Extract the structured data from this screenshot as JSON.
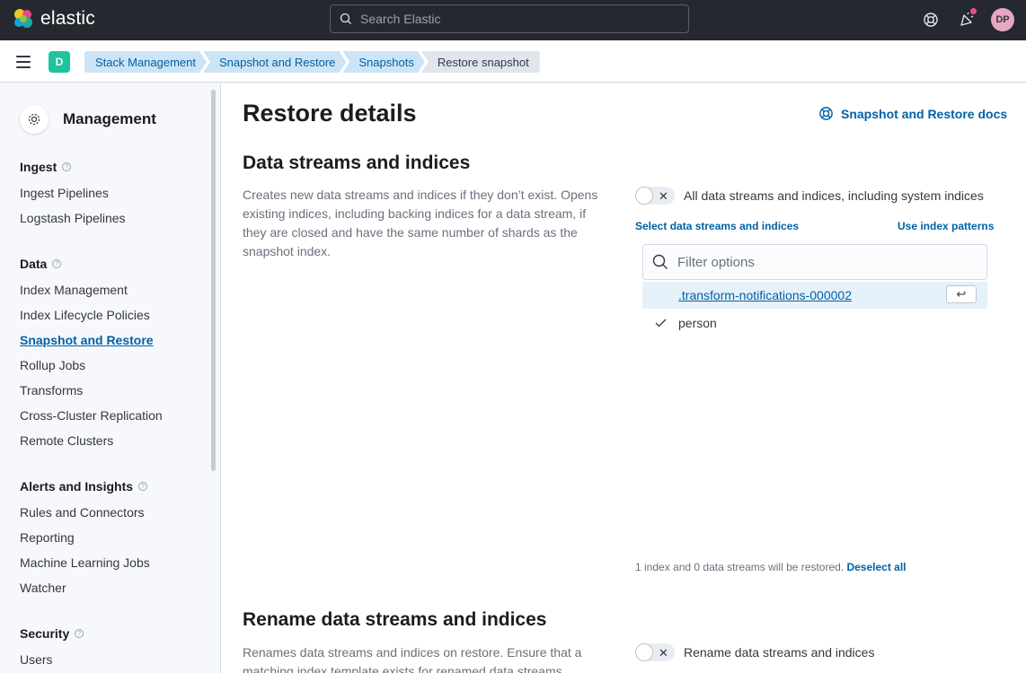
{
  "header": {
    "brand": "elastic",
    "search_placeholder": "Search Elastic",
    "avatar_initials": "DP"
  },
  "space_badge": "D",
  "breadcrumbs": [
    "Stack Management",
    "Snapshot and Restore",
    "Snapshots",
    "Restore snapshot"
  ],
  "sidebar": {
    "title": "Management",
    "groups": [
      {
        "label": "Ingest",
        "items": [
          "Ingest Pipelines",
          "Logstash Pipelines"
        ]
      },
      {
        "label": "Data",
        "items": [
          "Index Management",
          "Index Lifecycle Policies",
          "Snapshot and Restore",
          "Rollup Jobs",
          "Transforms",
          "Cross-Cluster Replication",
          "Remote Clusters"
        ]
      },
      {
        "label": "Alerts and Insights",
        "items": [
          "Rules and Connectors",
          "Reporting",
          "Machine Learning Jobs",
          "Watcher"
        ]
      },
      {
        "label": "Security",
        "items": [
          "Users"
        ]
      }
    ],
    "active_item": "Snapshot and Restore"
  },
  "main": {
    "title": "Restore details",
    "docs_link": "Snapshot and Restore docs",
    "section1": {
      "title": "Data streams and indices",
      "description": "Creates new data streams and indices if they don’t exist. Opens existing indices, including backing indices for a data stream, if they are closed and have the same number of shards as the snapshot index.",
      "toggle_label": "All data streams and indices, including system indices",
      "toggle_on": false,
      "select_link": "Select data streams and indices",
      "patterns_link": "Use index patterns",
      "filter_placeholder": "Filter options",
      "options": [
        {
          "label": ".transform-notifications-000002",
          "checked": false,
          "highlighted": true
        },
        {
          "label": "person",
          "checked": true,
          "highlighted": false
        }
      ],
      "summary": "1 index and 0 data streams will be restored.",
      "deselect_all": "Deselect all"
    },
    "section2": {
      "title": "Rename data streams and indices",
      "description": "Renames data streams and indices on restore. Ensure that a matching index template exists for renamed data streams.",
      "toggle_label": "Rename data streams and indices",
      "toggle_on": false
    }
  },
  "colors": {
    "header_bg": "#25282f",
    "link": "#0061a6",
    "crumb_bg": "#cce4f5",
    "space_badge": "#20c49c",
    "avatar": "#e7a6c1"
  }
}
